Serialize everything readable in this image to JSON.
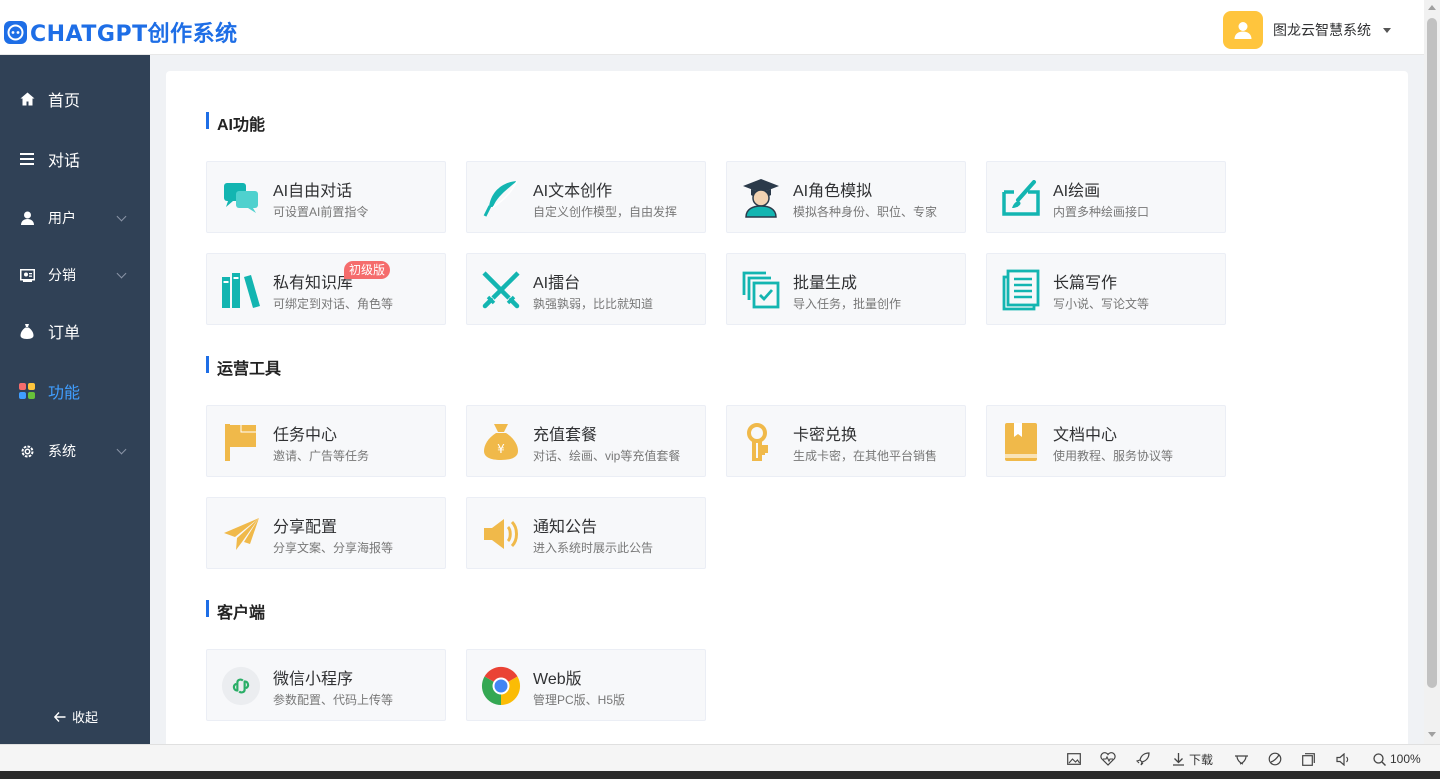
{
  "header": {
    "logo_text": "CHATGPT创作系统",
    "user_name": "图龙云智慧系统"
  },
  "sidebar": {
    "items": [
      {
        "label": "首页",
        "icon": "home-icon"
      },
      {
        "label": "对话",
        "icon": "list-icon"
      },
      {
        "label": "用户",
        "icon": "user-icon"
      },
      {
        "label": "分销",
        "icon": "distribution-icon"
      },
      {
        "label": "订单",
        "icon": "money-bag-icon"
      },
      {
        "label": "功能",
        "icon": "apps-icon"
      },
      {
        "label": "系统",
        "icon": "gear-icon"
      }
    ],
    "collapse_label": "收起",
    "active_color": "#409eff"
  },
  "sections": [
    {
      "title": "AI功能",
      "cards": [
        {
          "title": "AI自由对话",
          "sub": "可设置AI前置指令",
          "icon": "chat-bubbles-icon"
        },
        {
          "title": "AI文本创作",
          "sub": "自定义创作模型，自由发挥",
          "icon": "feather-icon"
        },
        {
          "title": "AI角色模拟",
          "sub": "模拟各种身份、职位、专家",
          "icon": "graduate-icon"
        },
        {
          "title": "AI绘画",
          "sub": "内置多种绘画接口",
          "icon": "paint-icon"
        },
        {
          "title": "私有知识库",
          "sub": "可绑定到对话、角色等",
          "icon": "books-icon",
          "badge": "初级版"
        },
        {
          "title": "AI擂台",
          "sub": "孰强孰弱，比比就知道",
          "icon": "swords-icon"
        },
        {
          "title": "批量生成",
          "sub": "导入任务，批量创作",
          "icon": "batch-icon"
        },
        {
          "title": "长篇写作",
          "sub": "写小说、写论文等",
          "icon": "document-icon"
        }
      ]
    },
    {
      "title": "运营工具",
      "cards": [
        {
          "title": "任务中心",
          "sub": "邀请、广告等任务",
          "icon": "flag-icon"
        },
        {
          "title": "充值套餐",
          "sub": "对话、绘画、vip等充值套餐",
          "icon": "money-bag-icon"
        },
        {
          "title": "卡密兑换",
          "sub": "生成卡密，在其他平台销售",
          "icon": "key-icon"
        },
        {
          "title": "文档中心",
          "sub": "使用教程、服务协议等",
          "icon": "book-icon"
        },
        {
          "title": "分享配置",
          "sub": "分享文案、分享海报等",
          "icon": "paper-plane-icon"
        },
        {
          "title": "通知公告",
          "sub": "进入系统时展示此公告",
          "icon": "speaker-icon"
        }
      ]
    },
    {
      "title": "客户端",
      "cards": [
        {
          "title": "微信小程序",
          "sub": "参数配置、代码上传等",
          "icon": "mini-program-icon"
        },
        {
          "title": "Web版",
          "sub": "管理PC版、H5版",
          "icon": "chrome-icon"
        }
      ]
    }
  ],
  "colors": {
    "accent": "#1e6ee6",
    "teal": "#13b5b1",
    "gold": "#f0b94a",
    "sidebar_bg": "#304156"
  },
  "statusbar": {
    "download_label": "下载",
    "zoom_label": "100%"
  }
}
